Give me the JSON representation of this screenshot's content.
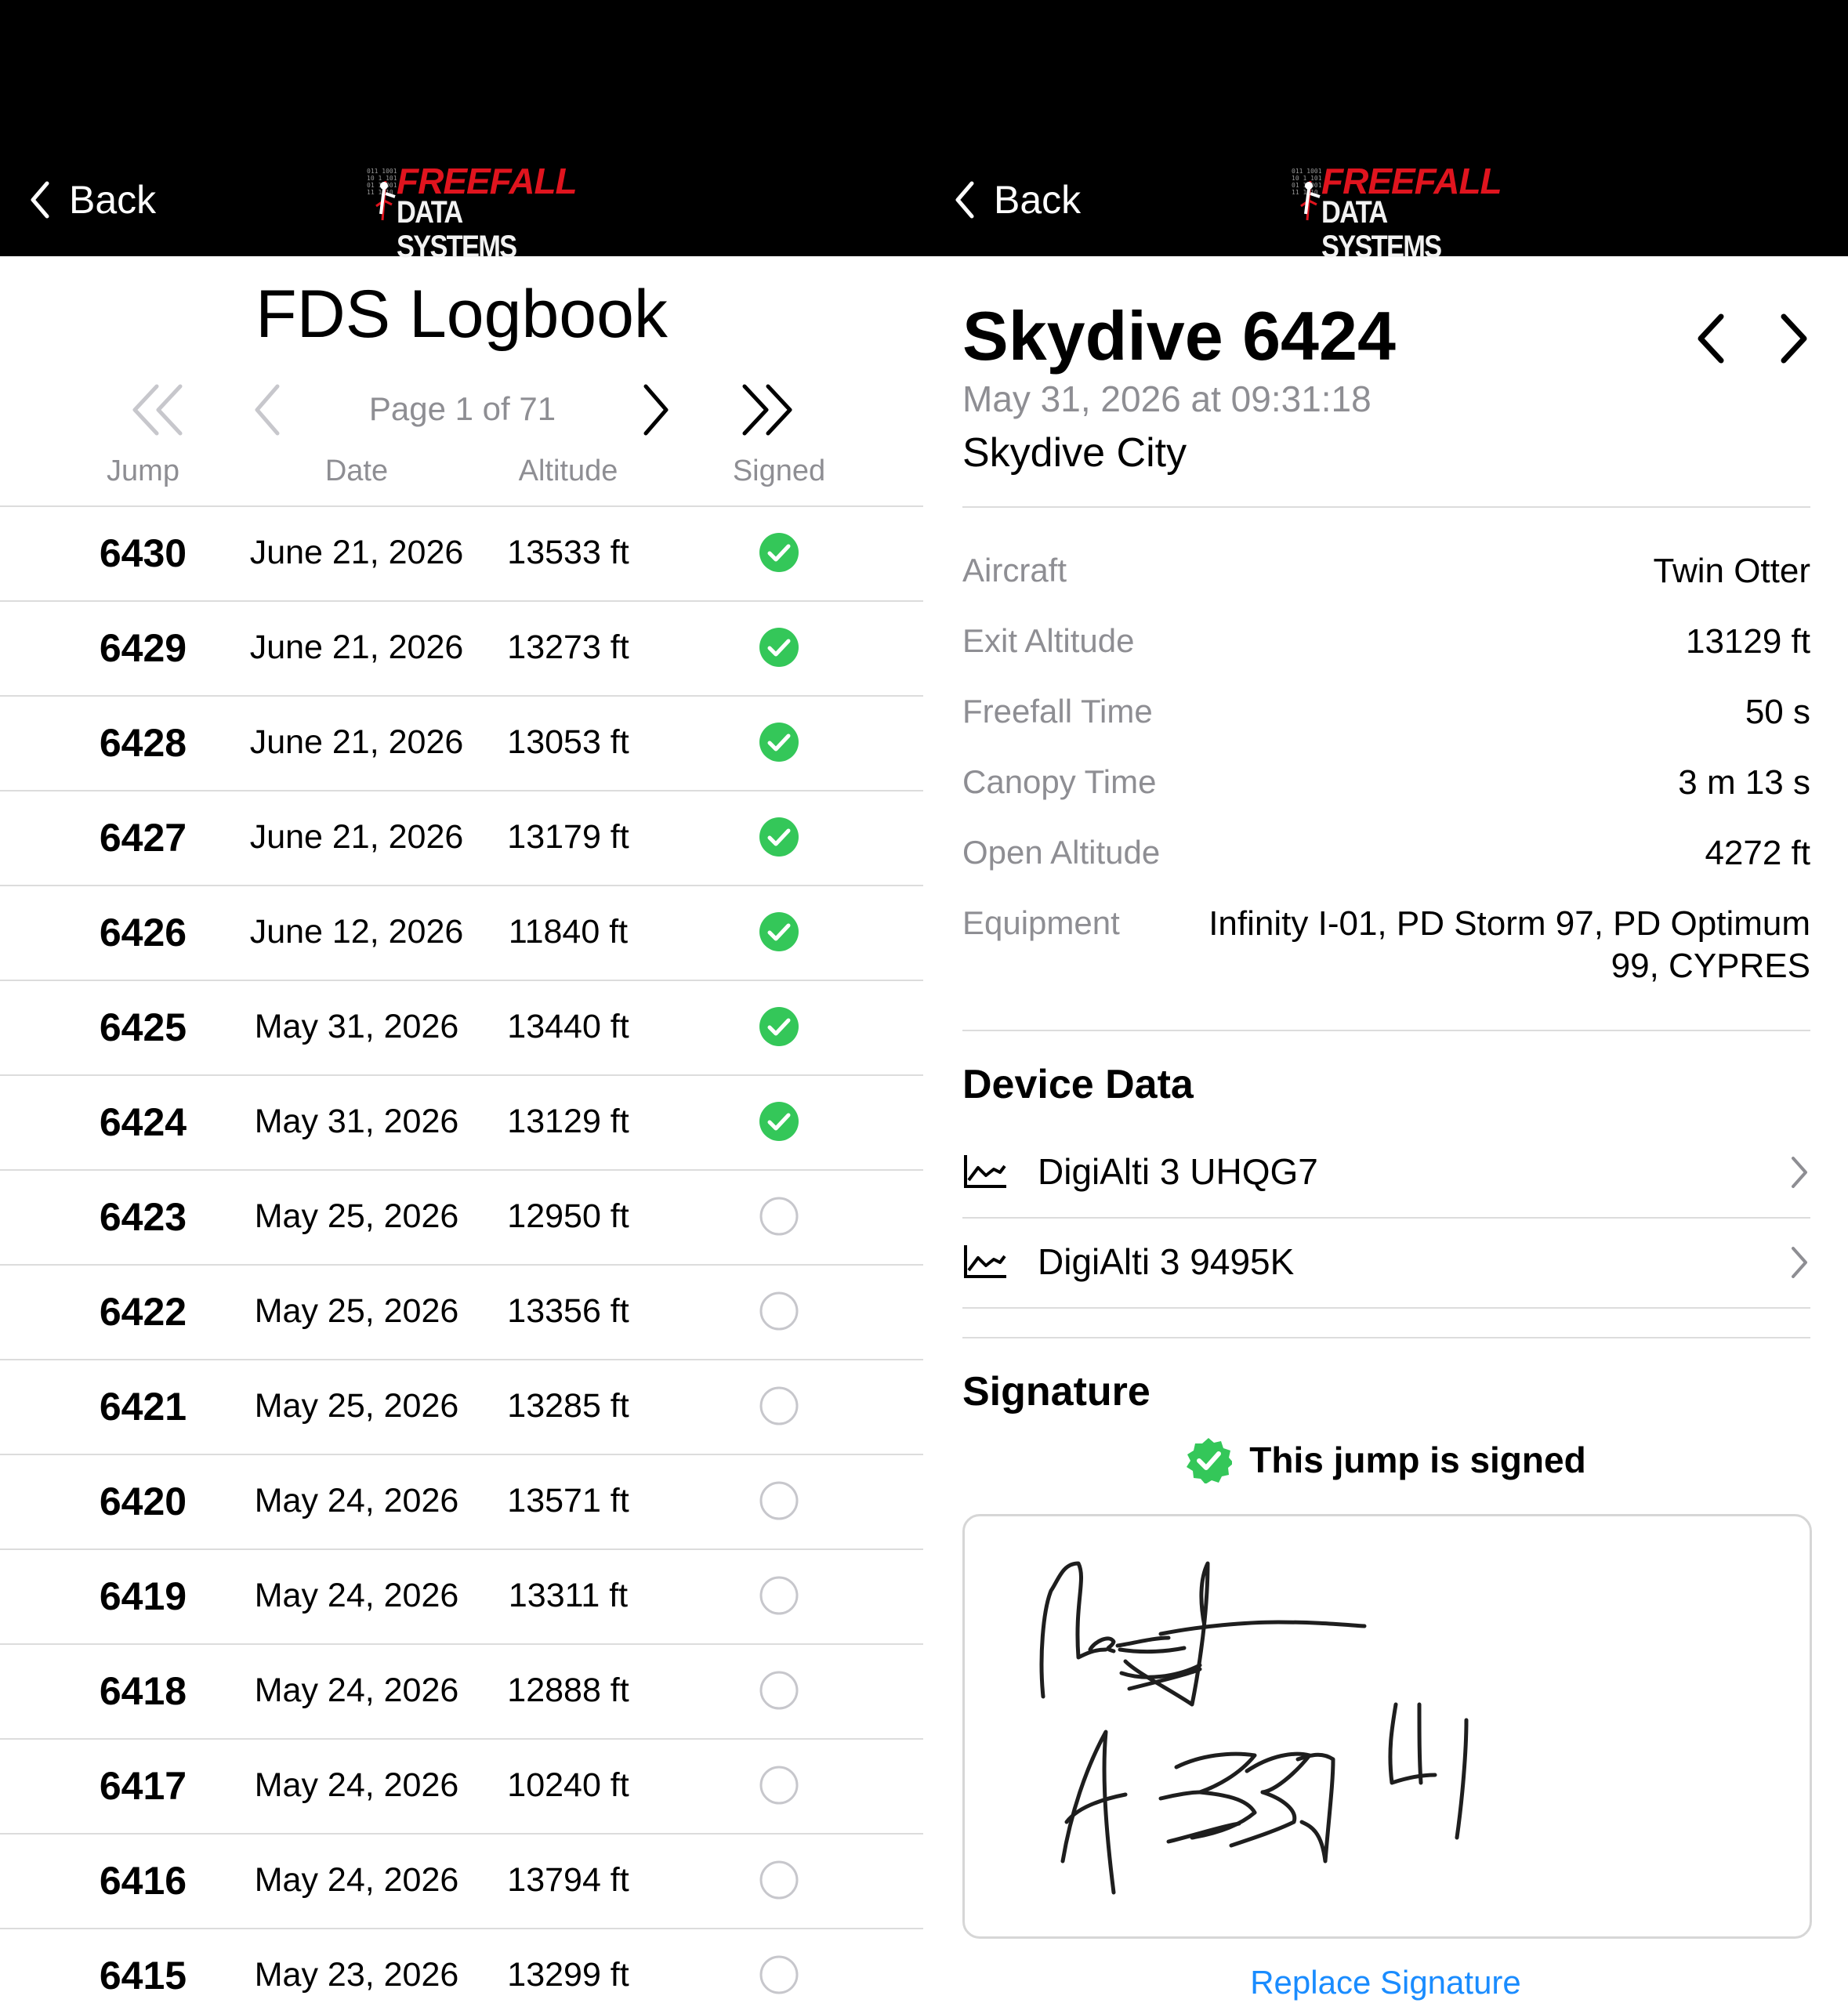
{
  "nav": {
    "back_label": "Back",
    "logo_line1": "FREEFALL",
    "logo_line2": "DATA SYSTEMS"
  },
  "logbook": {
    "title": "FDS Logbook",
    "page_text": "Page 1 of 71",
    "columns": [
      "Jump",
      "Date",
      "Altitude",
      "Signed"
    ],
    "rows": [
      {
        "jump": "6430",
        "date": "June 21, 2026",
        "altitude": "13533 ft",
        "signed": true
      },
      {
        "jump": "6429",
        "date": "June 21, 2026",
        "altitude": "13273 ft",
        "signed": true
      },
      {
        "jump": "6428",
        "date": "June 21, 2026",
        "altitude": "13053 ft",
        "signed": true
      },
      {
        "jump": "6427",
        "date": "June 21, 2026",
        "altitude": "13179 ft",
        "signed": true
      },
      {
        "jump": "6426",
        "date": "June 12, 2026",
        "altitude": "11840 ft",
        "signed": true
      },
      {
        "jump": "6425",
        "date": "May 31, 2026",
        "altitude": "13440 ft",
        "signed": true
      },
      {
        "jump": "6424",
        "date": "May 31, 2026",
        "altitude": "13129 ft",
        "signed": true
      },
      {
        "jump": "6423",
        "date": "May 25, 2026",
        "altitude": "12950 ft",
        "signed": false
      },
      {
        "jump": "6422",
        "date": "May 25, 2026",
        "altitude": "13356 ft",
        "signed": false
      },
      {
        "jump": "6421",
        "date": "May 25, 2026",
        "altitude": "13285 ft",
        "signed": false
      },
      {
        "jump": "6420",
        "date": "May 24, 2026",
        "altitude": "13571 ft",
        "signed": false
      },
      {
        "jump": "6419",
        "date": "May 24, 2026",
        "altitude": "13311 ft",
        "signed": false
      },
      {
        "jump": "6418",
        "date": "May 24, 2026",
        "altitude": "12888 ft",
        "signed": false
      },
      {
        "jump": "6417",
        "date": "May 24, 2026",
        "altitude": "10240 ft",
        "signed": false
      },
      {
        "jump": "6416",
        "date": "May 24, 2026",
        "altitude": "13794 ft",
        "signed": false
      },
      {
        "jump": "6415",
        "date": "May 23, 2026",
        "altitude": "13299 ft",
        "signed": false
      }
    ]
  },
  "detail": {
    "title": "Skydive 6424",
    "datetime": "May 31, 2026 at 09:31:18",
    "location": "Skydive City",
    "info": [
      {
        "label": "Aircraft",
        "value": "Twin Otter"
      },
      {
        "label": "Exit Altitude",
        "value": "13129 ft"
      },
      {
        "label": "Freefall Time",
        "value": "50 s"
      },
      {
        "label": "Canopy Time",
        "value": "3 m 13 s"
      },
      {
        "label": "Open Altitude",
        "value": "4272 ft"
      },
      {
        "label": "Equipment",
        "value_line1": "Infinity I-01, PD Storm 97, PD Optimum",
        "value_line2": "99, CYPRES"
      }
    ],
    "device_section": "Device Data",
    "devices": [
      "DigiAlti 3 UHQG7",
      "DigiAlti 3 9495K"
    ],
    "signature_section": "Signature",
    "signed_text": "This jump is signed",
    "replace_label": "Replace Signature"
  },
  "colors": {
    "check_green": "#34c759",
    "link_blue": "#1a8cff",
    "muted_gray": "#8e8e93"
  },
  "icons": [
    "chevron-left-icon",
    "chevron-double-left-icon",
    "chevron-right-icon",
    "chevron-double-right-icon",
    "checkmark-circle-icon",
    "empty-circle-icon",
    "line-chart-icon",
    "verified-badge-icon"
  ]
}
